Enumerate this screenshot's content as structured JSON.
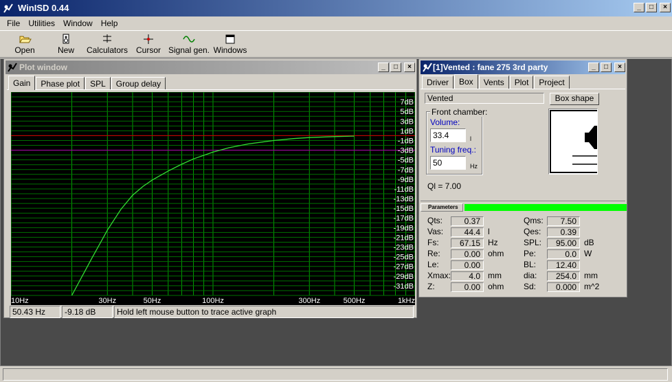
{
  "app": {
    "title": "WinISD 0.44"
  },
  "menu": [
    "File",
    "Utilities",
    "Window",
    "Help"
  ],
  "toolbar": {
    "open": "Open",
    "new": "New",
    "calculators": "Calculators",
    "cursor": "Cursor",
    "signal_gen": "Signal gen.",
    "windows": "Windows"
  },
  "plot_window": {
    "title": "Plot window",
    "tabs": [
      "Gain",
      "Phase plot",
      "SPL",
      "Group delay"
    ],
    "active_tab": "Gain",
    "status": {
      "frequency": "50.43 Hz",
      "gain": "-9.18 dB",
      "hint": "Hold left mouse button to trace active graph"
    }
  },
  "chart_data": {
    "type": "line",
    "x_scale": "log",
    "xlim": [
      10,
      1000
    ],
    "ylim": [
      -33,
      9
    ],
    "x_ticks": [
      {
        "value": 10,
        "label": "10Hz"
      },
      {
        "value": 30,
        "label": "30Hz"
      },
      {
        "value": 50,
        "label": "50Hz"
      },
      {
        "value": 100,
        "label": "100Hz"
      },
      {
        "value": 300,
        "label": "300Hz"
      },
      {
        "value": 500,
        "label": "500Hz"
      },
      {
        "value": 1000,
        "label": "1kHz"
      }
    ],
    "y_ticks": [
      {
        "value": 7,
        "label": "7dB"
      },
      {
        "value": 5,
        "label": "5dB"
      },
      {
        "value": 3,
        "label": "3dB"
      },
      {
        "value": 1,
        "label": "1dB"
      },
      {
        "value": -1,
        "label": "-1dB"
      },
      {
        "value": -3,
        "label": "-3dB"
      },
      {
        "value": -5,
        "label": "-5dB"
      },
      {
        "value": -7,
        "label": "-7dB"
      },
      {
        "value": -9,
        "label": "-9dB"
      },
      {
        "value": -11,
        "label": "-11dB"
      },
      {
        "value": -13,
        "label": "-13dB"
      },
      {
        "value": -15,
        "label": "-15dB"
      },
      {
        "value": -17,
        "label": "-17dB"
      },
      {
        "value": -19,
        "label": "-19dB"
      },
      {
        "value": -21,
        "label": "-21dB"
      },
      {
        "value": -23,
        "label": "-23dB"
      },
      {
        "value": -25,
        "label": "-25dB"
      },
      {
        "value": -27,
        "label": "-27dB"
      },
      {
        "value": -29,
        "label": "-29dB"
      },
      {
        "value": -31,
        "label": "-31dB"
      }
    ],
    "reference_lines": [
      {
        "value": 0,
        "color": "#c00000"
      },
      {
        "value": -3,
        "color": "#a000a0"
      }
    ],
    "grid": true,
    "series": [
      {
        "color": "#33dd33",
        "points": [
          [
            20,
            -33
          ],
          [
            25,
            -25.5
          ],
          [
            30,
            -19.5
          ],
          [
            35,
            -15.2
          ],
          [
            40,
            -12.3
          ],
          [
            45,
            -10.5
          ],
          [
            50,
            -9.18
          ],
          [
            60,
            -7.3
          ],
          [
            70,
            -5.9
          ],
          [
            80,
            -4.8
          ],
          [
            100,
            -3.4
          ],
          [
            120,
            -2.5
          ],
          [
            150,
            -1.7
          ],
          [
            200,
            -1.0
          ],
          [
            250,
            -0.6
          ],
          [
            300,
            -0.4
          ],
          [
            400,
            -0.2
          ],
          [
            500,
            -0.1
          ]
        ]
      }
    ]
  },
  "vented_window": {
    "title": "[1]Vented : fane 275 3rd party",
    "tabs": [
      "Driver",
      "Box",
      "Vents",
      "Plot",
      "Project"
    ],
    "active_tab": "Box",
    "box_type": "Vented",
    "box_shape_button": "Box shape",
    "front_chamber": {
      "label": "Front chamber:",
      "volume_label": "Volume:",
      "volume_value": "33.4",
      "volume_unit": "l",
      "tuning_label": "Tuning freq.:",
      "tuning_value": "50",
      "tuning_unit": "Hz"
    },
    "ql": "Ql = 7.00",
    "parameters_label": "Parameters",
    "params_left": [
      {
        "name": "Qts:",
        "value": "0.37",
        "unit": ""
      },
      {
        "name": "Vas:",
        "value": "44.4",
        "unit": "l"
      },
      {
        "name": "Fs:",
        "value": "67.15",
        "unit": "Hz"
      },
      {
        "name": "Re:",
        "value": "0.00",
        "unit": "ohm"
      },
      {
        "name": "Le:",
        "value": "0.00",
        "unit": ""
      },
      {
        "name": "Xmax:",
        "value": "4.0",
        "unit": "mm"
      },
      {
        "name": "Z:",
        "value": "0.00",
        "unit": "ohm"
      }
    ],
    "params_right": [
      {
        "name": "Qms:",
        "value": "7.50",
        "unit": ""
      },
      {
        "name": "Qes:",
        "value": "0.39",
        "unit": ""
      },
      {
        "name": "SPL:",
        "value": "95.00",
        "unit": "dB"
      },
      {
        "name": "Pe:",
        "value": "0.0",
        "unit": "W"
      },
      {
        "name": "BL:",
        "value": "12.40",
        "unit": ""
      },
      {
        "name": "dia:",
        "value": "254.0",
        "unit": "mm"
      },
      {
        "name": "Sd:",
        "value": "0.000",
        "unit": "m^2"
      }
    ]
  },
  "colors": {
    "title_active": "#0a246a",
    "title_inactive": "#808080",
    "progress": "#00ff00",
    "face": "#d4d0c8"
  }
}
